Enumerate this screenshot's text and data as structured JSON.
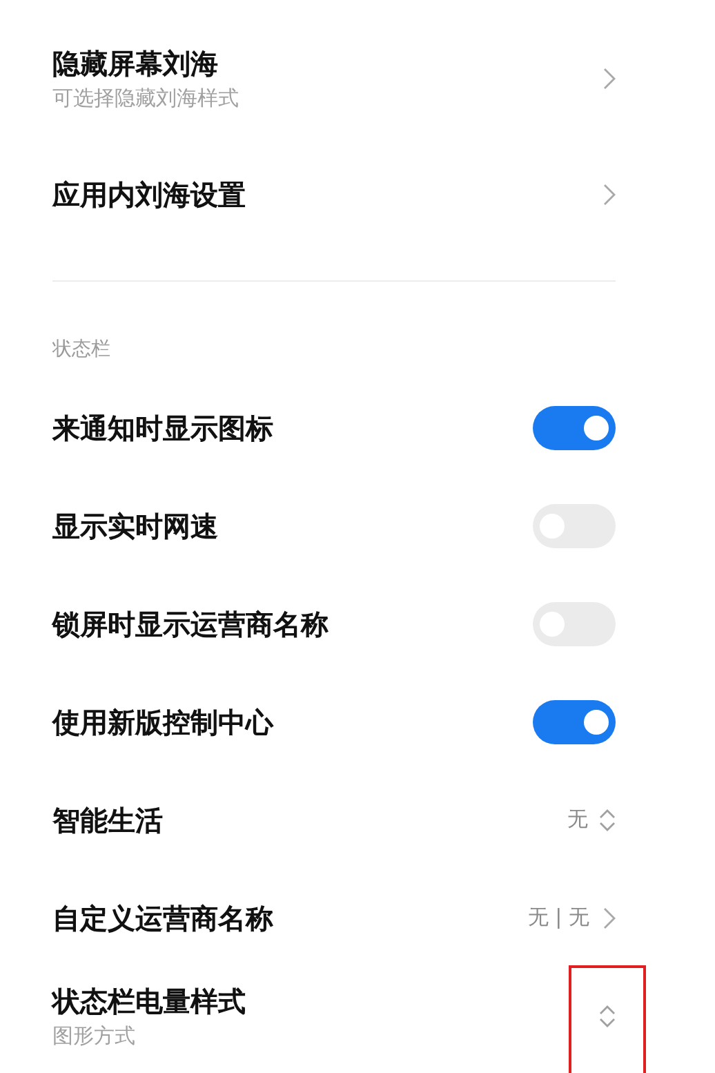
{
  "notch_settings": [
    {
      "kind": "link",
      "title": "隐藏屏幕刘海",
      "subtitle": "可选择隐藏刘海样式"
    },
    {
      "kind": "link",
      "title": "应用内刘海设置"
    }
  ],
  "status_bar_section": {
    "header": "状态栏",
    "items": [
      {
        "kind": "toggle",
        "title": "来通知时显示图标",
        "on": true
      },
      {
        "kind": "toggle",
        "title": "显示实时网速",
        "on": false
      },
      {
        "kind": "toggle",
        "title": "锁屏时显示运营商名称",
        "on": false
      },
      {
        "kind": "toggle",
        "title": "使用新版控制中心",
        "on": true
      },
      {
        "kind": "select",
        "title": "智能生活",
        "value": "无",
        "highlighted": false
      },
      {
        "kind": "link",
        "title": "自定义运营商名称",
        "value": "无 | 无"
      },
      {
        "kind": "select",
        "title": "状态栏电量样式",
        "subtitle": "图形方式",
        "highlighted": true
      }
    ]
  }
}
